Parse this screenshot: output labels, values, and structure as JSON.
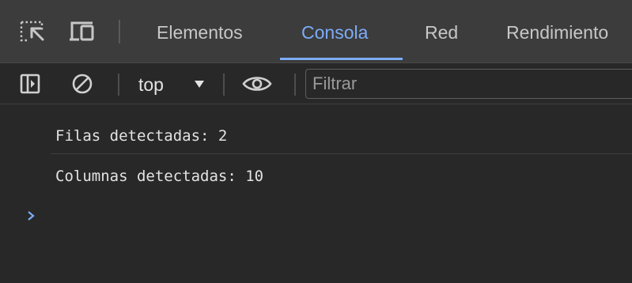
{
  "tabbar": {
    "icons": [
      "inspect-element-icon",
      "device-toolbar-icon"
    ],
    "tabs": [
      {
        "label": "Elementos",
        "active": false
      },
      {
        "label": "Consola",
        "active": true
      },
      {
        "label": "Red",
        "active": false
      },
      {
        "label": "Rendimiento",
        "active": false
      }
    ]
  },
  "toolbar": {
    "icons": [
      "sidebar-toggle-icon",
      "clear-console-icon",
      "live-expression-eye-icon"
    ],
    "context": "top",
    "filter": {
      "placeholder": "Filtrar",
      "value": ""
    }
  },
  "console": {
    "messages": [
      {
        "text": "Filas detectadas: 2"
      },
      {
        "text": "Columnas detectadas: 10"
      }
    ],
    "prompt_icon": "chevron-right-icon"
  },
  "colors": {
    "background": "#282828",
    "tabbar_background": "#3c3c3c",
    "accent": "#7cacf8",
    "text": "#e3e3e3"
  }
}
